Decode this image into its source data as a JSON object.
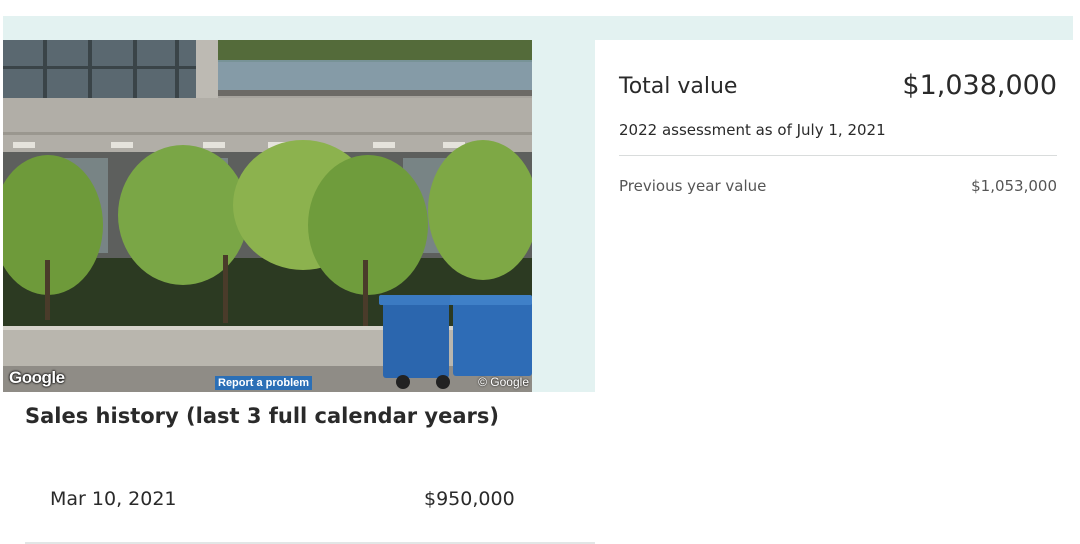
{
  "photo": {
    "logo_text": "Google",
    "report_label": "Report a problem",
    "copyright": "© Google"
  },
  "assessment": {
    "total_label": "Total value",
    "total_value": "$1,038,000",
    "note": "2022 assessment as of July 1, 2021",
    "previous_label": "Previous year value",
    "previous_value": "$1,053,000"
  },
  "sales": {
    "title": "Sales history (last 3 full calendar years)",
    "rows": [
      {
        "date": "Mar 10, 2021",
        "price": "$950,000"
      }
    ]
  }
}
